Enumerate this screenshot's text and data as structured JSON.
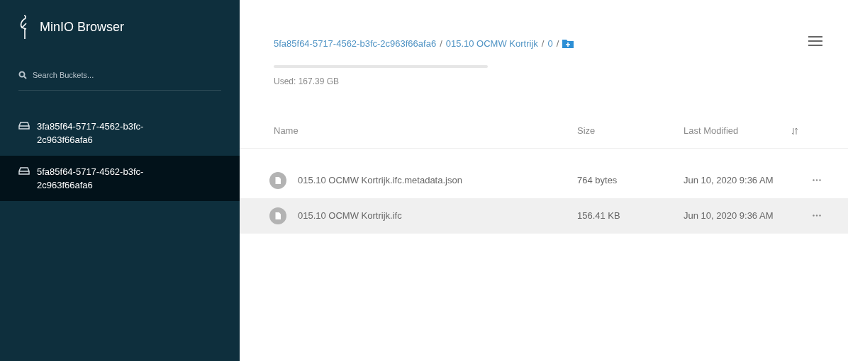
{
  "sidebar": {
    "title": "MinIO Browser",
    "search": {
      "placeholder": "Search Buckets..."
    },
    "buckets": [
      {
        "name": "3fa85f64-5717-4562-b3fc-2c963f66afa6",
        "selected": false
      },
      {
        "name": "5fa85f64-5717-4562-b3fc-2c963f66afa6",
        "selected": true
      }
    ]
  },
  "header": {
    "breadcrumb": [
      "5fa85f64-5717-4562-b3fc-2c963f66afa6",
      "015.10 OCMW Kortrijk",
      "0"
    ],
    "separator": "/",
    "used": "Used: 167.39 GB"
  },
  "table": {
    "columns": [
      "Name",
      "Size",
      "Last Modified"
    ],
    "rows": [
      {
        "name": "015.10 OCMW Kortrijk.ifc.metadata.json",
        "size": "764 bytes",
        "modified": "Jun 10, 2020 9:36 AM",
        "selected": false
      },
      {
        "name": "015.10 OCMW Kortrijk.ifc",
        "size": "156.41 KB",
        "modified": "Jun 10, 2020 9:36 AM",
        "selected": true
      }
    ]
  }
}
